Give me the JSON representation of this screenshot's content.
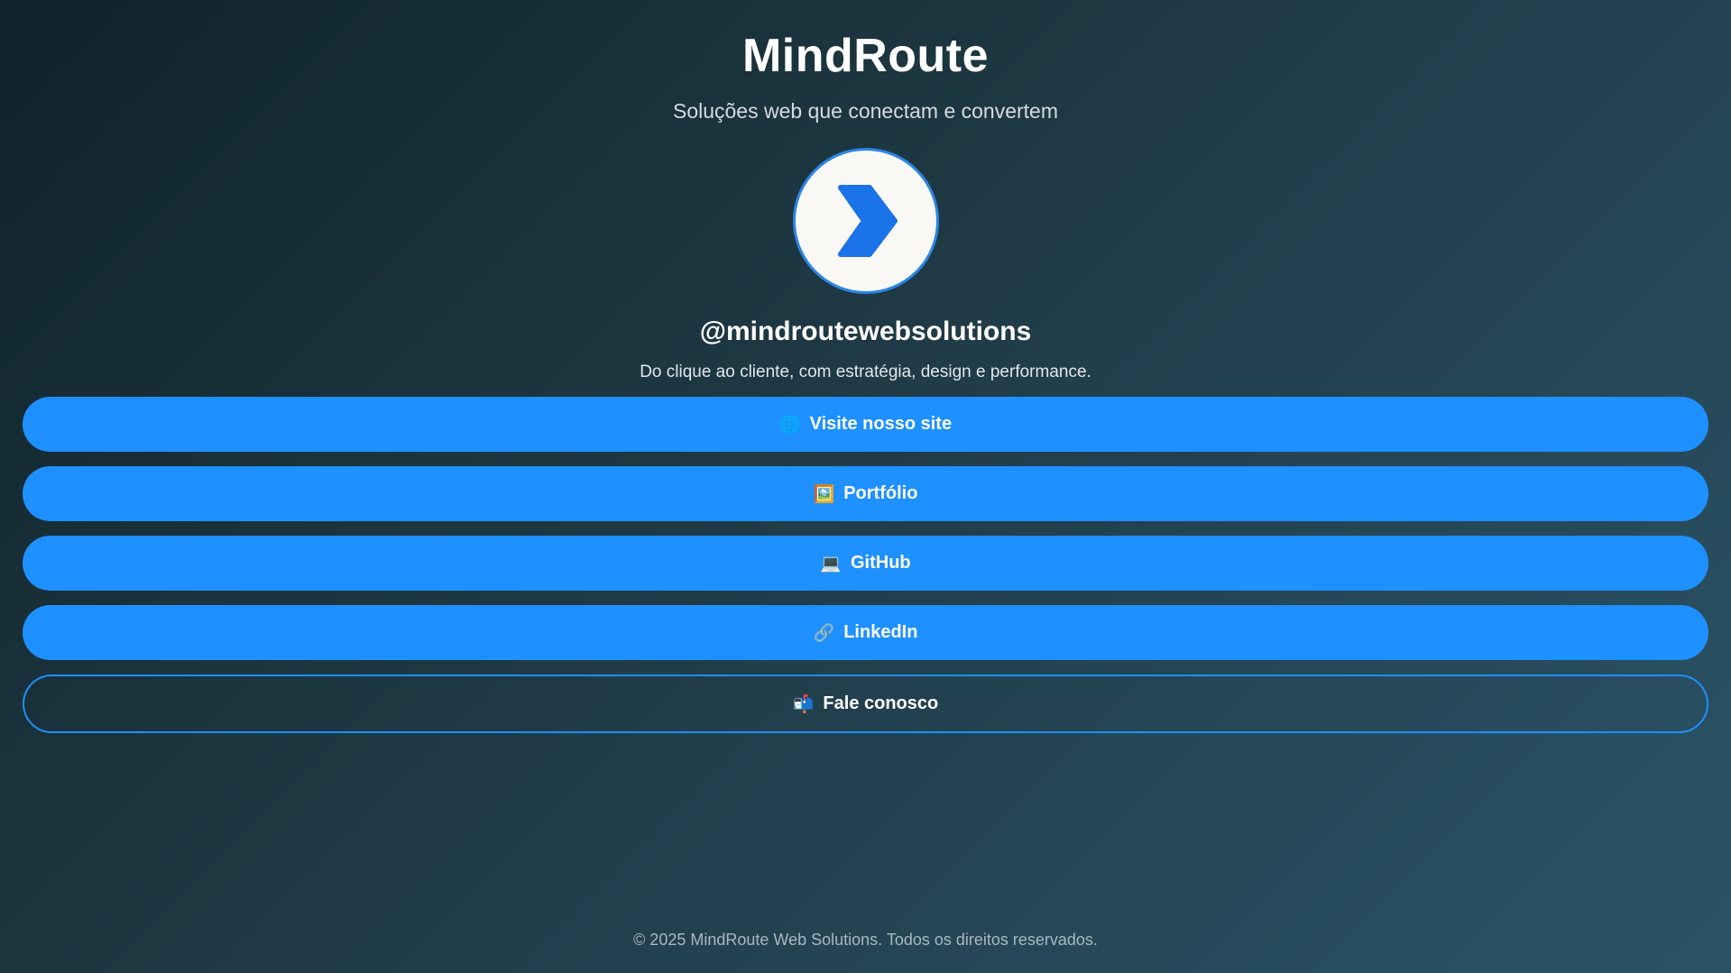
{
  "header": {
    "title": "MindRoute",
    "tagline": "Soluções web que conectam e convertem"
  },
  "profile": {
    "avatar_icon": "chevron-right-icon",
    "avatar_color": "#1a73e8",
    "handle": "@mindroutewebsolutions",
    "bio": "Do clique ao cliente, com estratégia, design e performance."
  },
  "links": [
    {
      "emoji": "🌐",
      "icon": "globe-icon",
      "label": "Visite nosso site"
    },
    {
      "emoji": "🖼️",
      "icon": "picture-icon",
      "label": "Portfólio"
    },
    {
      "emoji": "💻",
      "icon": "laptop-icon",
      "label": "GitHub"
    },
    {
      "emoji": "🔗",
      "icon": "link-icon",
      "label": "LinkedIn"
    },
    {
      "emoji": "📬",
      "icon": "mailbox-icon",
      "label": "Fale conosco"
    }
  ],
  "footer": {
    "text": "© 2025 MindRoute Web Solutions. Todos os direitos reservados."
  },
  "colors": {
    "accent": "#1e90ff",
    "background_start": "#10232a",
    "background_end": "#2b5468"
  }
}
